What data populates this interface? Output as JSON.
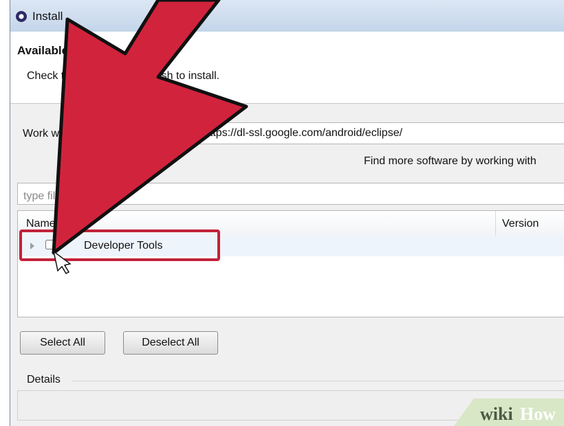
{
  "window": {
    "title": "Install"
  },
  "header": {
    "title": "Available Software",
    "description": "Check the items that you wish to install."
  },
  "work_with": {
    "label": "Work with:",
    "value": "https://dl-ssl.google.com/android/eclipse/",
    "find_more": "Find more software by working with"
  },
  "filter": {
    "placeholder": "type filter text"
  },
  "tree": {
    "columns": [
      "Name",
      "Version"
    ],
    "rows": [
      {
        "label": "Developer Tools",
        "checked": false,
        "expanded": false
      }
    ]
  },
  "buttons": {
    "select_all": "Select All",
    "deselect_all": "Deselect All"
  },
  "details": {
    "label": "Details"
  },
  "annotation": {
    "arrow_color": "#d2233d",
    "box_color": "#c2223a"
  },
  "watermark": {
    "wiki": "wiki",
    "how": "How"
  }
}
